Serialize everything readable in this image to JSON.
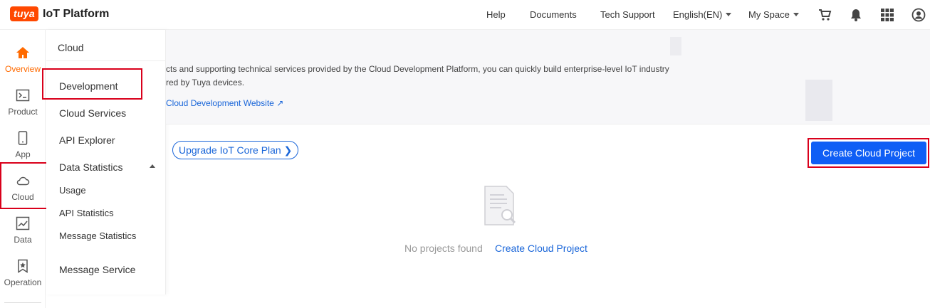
{
  "brand": {
    "badge": "tuya",
    "name": "IoT Platform"
  },
  "top_nav": {
    "help": "Help",
    "documents": "Documents",
    "tech_support": "Tech Support",
    "language": "English(EN)",
    "space": "My Space"
  },
  "rail": {
    "items": [
      {
        "label": "Overview",
        "icon": "home-icon"
      },
      {
        "label": "Product",
        "icon": "terminal-icon"
      },
      {
        "label": "App",
        "icon": "phone-icon"
      },
      {
        "label": "Cloud",
        "icon": "cloud-icon"
      },
      {
        "label": "Data",
        "icon": "chart-icon"
      },
      {
        "label": "Operation",
        "icon": "bookmark-icon"
      }
    ]
  },
  "submenu": {
    "title": "Cloud",
    "items": [
      "Development",
      "Cloud Services",
      "API Explorer",
      "Data Statistics",
      "Usage",
      "API Statistics",
      "Message Statistics",
      "Message Service"
    ]
  },
  "banner": {
    "line1": "cts and supporting technical services provided by the Cloud Development Platform, you can quickly build enterprise-level IoT industry",
    "line2": "red by Tuya devices.",
    "link": "Cloud Development Website ↗"
  },
  "main": {
    "upgrade_label": "Upgrade IoT Core Plan",
    "create_button": "Create Cloud Project",
    "empty_text": "No projects found",
    "empty_link": "Create Cloud Project"
  },
  "colors": {
    "brand": "#ff4800",
    "accent": "#0f5ef5",
    "link": "#1a66d9",
    "highlight": "#d9001b",
    "active": "#ff6a00"
  }
}
